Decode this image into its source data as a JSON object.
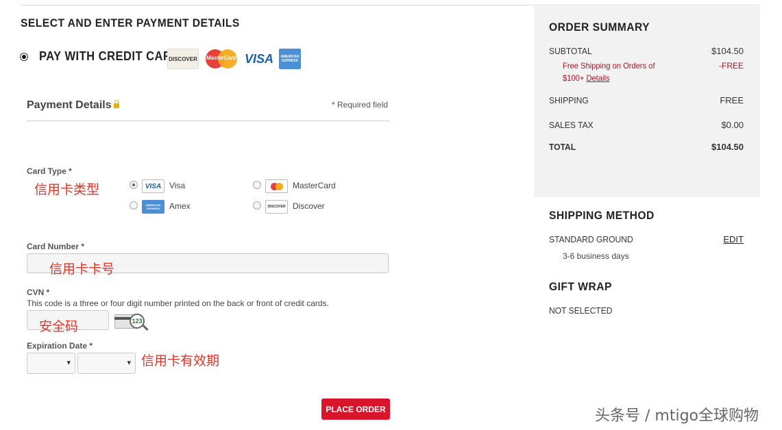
{
  "payment": {
    "section_title": "SELECT AND ENTER PAYMENT DETAILS",
    "pay_with_label": "PAY WITH CREDIT CARD",
    "accepted_logos": [
      "DISCOVER",
      "MasterCard",
      "VISA",
      "AMERICAN EXPRESS"
    ]
  },
  "form": {
    "title": "Payment Details",
    "required_note": "* Required field",
    "card_type_label": "Card Type *",
    "card_type_note": "信用卡类型",
    "card_options": [
      {
        "label": "Visa",
        "icon_text": "VISA",
        "selected": true
      },
      {
        "label": "MasterCard",
        "icon_text": "MC",
        "selected": false
      },
      {
        "label": "Amex",
        "icon_text": "AMERICAN EXPRESS",
        "selected": false
      },
      {
        "label": "Discover",
        "icon_text": "DISCOVER",
        "selected": false
      }
    ],
    "card_number_label": "Card Number *",
    "card_number_note": "信用卡卡号",
    "cvn_label": "CVN *",
    "cvn_help": "This code is a three or four digit number printed on the back or front of credit cards.",
    "cvn_note": "安全码",
    "cvn_badge": "123",
    "expiration_label": "Expiration Date *",
    "expiration_note": "信用卡有效期",
    "month_value": "",
    "year_value": "",
    "place_order_label": "PLACE ORDER"
  },
  "summary": {
    "title": "ORDER SUMMARY",
    "subtotal_label": "SUBTOTAL",
    "subtotal_value": "$104.50",
    "promo_line1": "Free Shipping on Orders of",
    "promo_line2": "$100+",
    "promo_link": "Details",
    "promo_value": "-FREE",
    "shipping_label": "SHIPPING",
    "shipping_value": "FREE",
    "tax_label": "SALES TAX",
    "tax_value": "$0.00",
    "total_label": "TOTAL",
    "total_value": "$104.50"
  },
  "shipping_method": {
    "title": "SHIPPING METHOD",
    "method": "STANDARD GROUND",
    "edit_label": "EDIT",
    "eta": "3-6 business days"
  },
  "gift_wrap": {
    "title": "GIFT WRAP",
    "status": "NOT SELECTED"
  },
  "watermark": "头条号 / mtigo全球购物",
  "colors": {
    "accent_red": "#d8152a",
    "promo_red": "#9b1b2a",
    "annotation_red": "#e0352a",
    "summary_bg": "#f2f2f2"
  }
}
